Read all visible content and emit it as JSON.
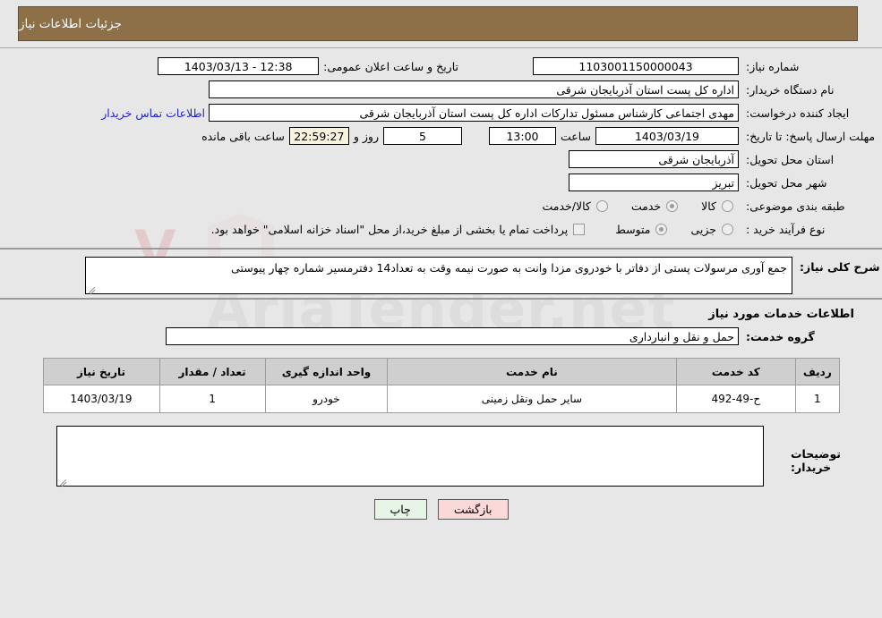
{
  "header": {
    "title": "جزئیات اطلاعات نیاز"
  },
  "watermark": {
    "text": "AriaTender.net"
  },
  "form": {
    "need_number_label": "شماره نیاز:",
    "need_number_value": "1103001150000043",
    "announce_label": "تاریخ و ساعت اعلان عمومی:",
    "announce_value": "12:38 - 1403/03/13",
    "buyer_org_label": "نام دستگاه خریدار:",
    "buyer_org_value": "اداره کل پست استان آذربایجان شرقی",
    "creator_label": "ایجاد کننده درخواست:",
    "creator_value": "مهدی اجتماعی کارشناس مسئول تدارکات اداره کل پست استان آذربایجان شرقی",
    "contact_link": "اطلاعات تماس خریدار",
    "deadline_label": "مهلت ارسال پاسخ: تا تاریخ:",
    "deadline_date": "1403/03/19",
    "hour_label": "ساعت",
    "deadline_time": "13:00",
    "days_remaining": "5",
    "days_unit_label": "روز و",
    "time_remaining": "22:59:27",
    "remaining_suffix_label": "ساعت باقی مانده",
    "province_label": "استان محل تحویل:",
    "province_value": "آذربایجان شرقی",
    "city_label": "شهر محل تحویل:",
    "city_value": "تبریز",
    "category_label": "طبقه بندی موضوعی:",
    "category_options": [
      {
        "label": "کالا",
        "checked": false
      },
      {
        "label": "خدمت",
        "checked": true
      },
      {
        "label": "کالا/خدمت",
        "checked": false
      }
    ],
    "process_label": "نوع فرآیند خرید :",
    "process_options": [
      {
        "label": "جزیی",
        "checked": false
      },
      {
        "label": "متوسط",
        "checked": true
      }
    ],
    "treasury_checkbox_label": "پرداخت تمام یا بخشی از مبلغ خرید،از محل \"اسناد خزانه اسلامی\" خواهد بود.",
    "treasury_checked": false
  },
  "description": {
    "label": "شرح کلی نیاز:",
    "value": "جمع آوری مرسولات پستی از دفاتر با خودروی  مزدا وانت     به صورت نیمه وقت     به تعداد14 دفترمسیر شماره چهار  پیوستی"
  },
  "services": {
    "section_title": "اطلاعات خدمات مورد نیاز",
    "group_label": "گروه خدمت:",
    "group_value": "حمل و نقل و انبارداری",
    "table": {
      "columns": [
        "ردیف",
        "کد خدمت",
        "نام خدمت",
        "واحد اندازه گیری",
        "تعداد / مقدار",
        "تاریخ نیاز"
      ],
      "rows": [
        [
          "1",
          "ح-49-492",
          "سایر حمل ونقل زمینی",
          "خودرو",
          "1",
          "1403/03/19"
        ]
      ]
    }
  },
  "buyer_notes": {
    "label": "توضیحات خریدار:",
    "value": ""
  },
  "buttons": {
    "print": "چاپ",
    "back": "بازگشت"
  },
  "colors": {
    "header_bg": "#8d7048",
    "page_bg": "#e7e7e7",
    "link": "#2222cc",
    "table_header_bg": "#cfcfcf",
    "countdown_bg": "#f7f3dd",
    "btn_print_bg": "#e6f5e6",
    "btn_back_bg": "#fbd9d9"
  }
}
